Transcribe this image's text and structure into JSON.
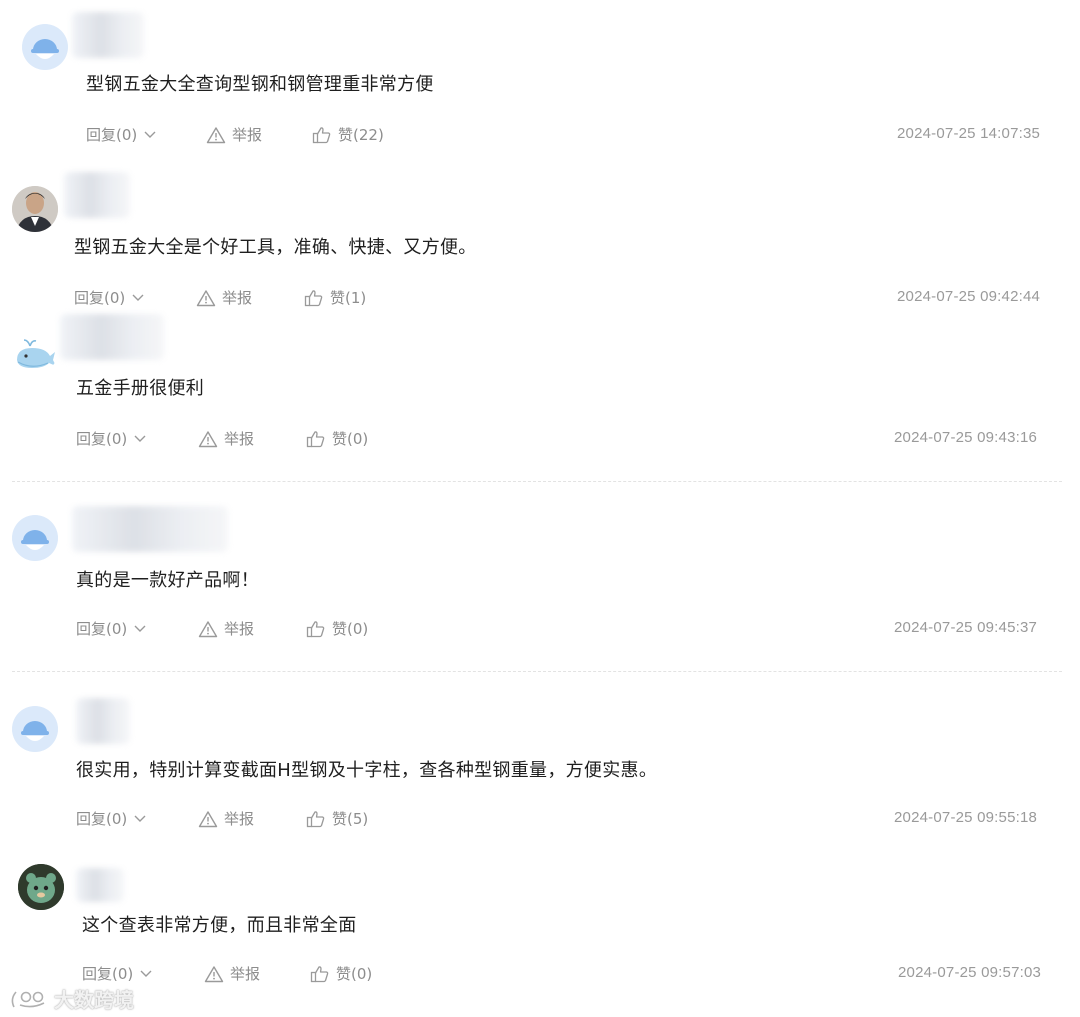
{
  "comments": [
    {
      "text": "型钢五金大全查询型钢和钢管理重非常方便",
      "reply": "回复(0)",
      "report": "举报",
      "like": "赞(22)",
      "time": "2024-07-25 14:07:35"
    },
    {
      "text": "型钢五金大全是个好工具，准确、快捷、又方便。",
      "reply": "回复(0)",
      "report": "举报",
      "like": "赞(1)",
      "time": "2024-07-25 09:42:44"
    },
    {
      "text": "五金手册很便利",
      "reply": "回复(0)",
      "report": "举报",
      "like": "赞(0)",
      "time": "2024-07-25 09:43:16"
    },
    {
      "text": "真的是一款好产品啊！",
      "reply": "回复(0)",
      "report": "举报",
      "like": "赞(0)",
      "time": "2024-07-25 09:45:37"
    },
    {
      "text": "很实用，特别计算变截面H型钢及十字柱，查各种型钢重量，方便实惠。",
      "reply": "回复(0)",
      "report": "举报",
      "like": "赞(5)",
      "time": "2024-07-25 09:55:18"
    },
    {
      "text": "这个查表非常方便，而且非常全面",
      "reply": "回复(0)",
      "report": "举报",
      "like": "赞(0)",
      "time": "2024-07-25 09:57:03"
    }
  ],
  "avatars": [
    "default-avatar-icon",
    "user-photo-avatar",
    "whale-avatar-icon",
    "default-avatar-icon",
    "default-avatar-icon",
    "plush-toy-avatar"
  ],
  "watermark": {
    "text": "大数跨境"
  },
  "colors": {
    "text": "#1f1f1f",
    "meta": "#8d8d8d",
    "avatar_bg": "#e6f0fb",
    "avatar_fg": "#7fb2ea"
  }
}
